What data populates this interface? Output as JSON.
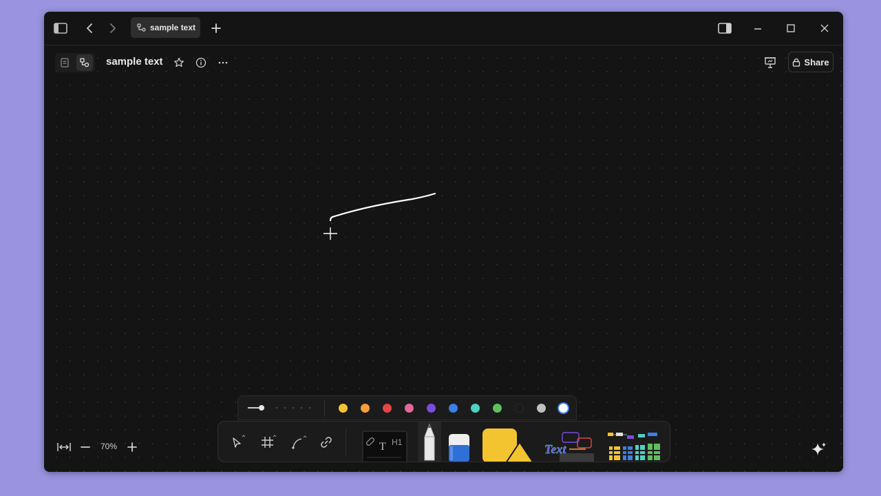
{
  "titlebar": {
    "tab_title": "sample text",
    "icons": [
      "sidebar-toggle-icon",
      "back-arrow-icon",
      "forward-arrow-icon",
      "edgeless-doc-icon",
      "new-tab-plus-icon",
      "split-view-icon",
      "minimize-icon",
      "maximize-icon",
      "close-icon"
    ]
  },
  "header": {
    "doc_title": "sample text",
    "modes": [
      "page-mode-icon",
      "edgeless-mode-icon"
    ],
    "share_label": "Share",
    "icons": [
      "star-icon",
      "info-icon",
      "more-dots-icon",
      "presentation-icon",
      "lock-icon"
    ]
  },
  "palette": {
    "colors": [
      "#f4c430",
      "#f59e3a",
      "#e64545",
      "#e0689a",
      "#7a4de0",
      "#3d7fe6",
      "#4fd1c5",
      "#5fbf5f",
      "#1a1a1a",
      "#c0c0c0",
      "#ffffff"
    ],
    "selected_color": "#ffffff"
  },
  "toolbar": {
    "tools": [
      "select-tool",
      "frame-tool",
      "connector-tool",
      "link-tool",
      "note-tool",
      "pen-tool",
      "eraser-tool",
      "shape-tool",
      "text-template-tool",
      "more-templates-tool"
    ]
  },
  "zoom": {
    "level": "70%"
  },
  "colors": {
    "accent": "#9a94e0",
    "window_bg": "#141414"
  }
}
